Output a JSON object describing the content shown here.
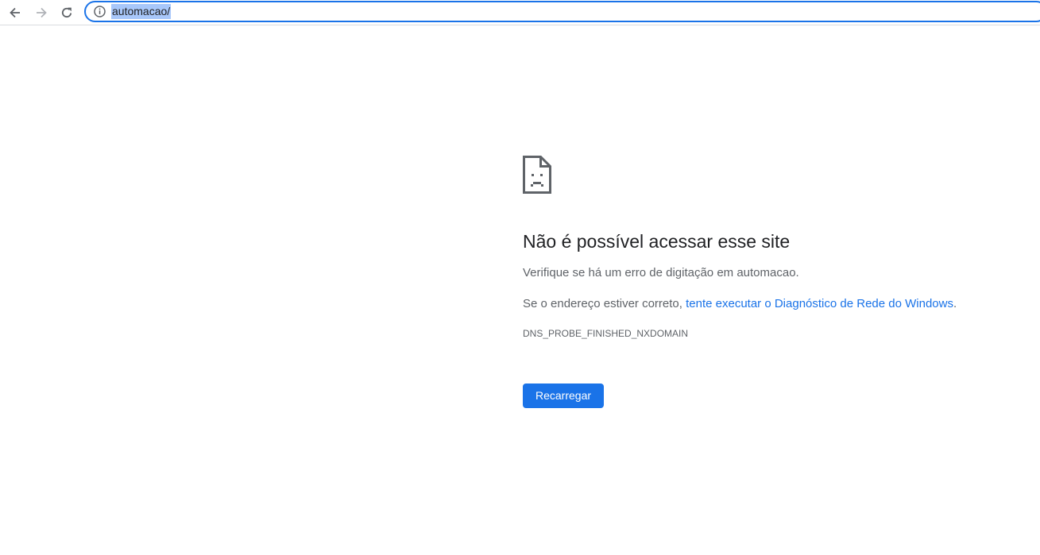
{
  "browser": {
    "url": "automacao/",
    "accent_color": "#1a73e8",
    "icons": [
      "back-icon",
      "forward-icon",
      "reload-icon",
      "info-icon"
    ]
  },
  "error_page": {
    "icon": "sad-document-icon",
    "title": "Não é possível acessar esse site",
    "line1": "Verifique se há um erro de digitação em automacao.",
    "line2_prefix": "Se o endereço estiver correto, ",
    "line2_link": "tente executar o Diagnóstico de Rede do Windows",
    "line2_suffix": ".",
    "error_code": "DNS_PROBE_FINISHED_NXDOMAIN",
    "reload_button": "Recarregar"
  }
}
